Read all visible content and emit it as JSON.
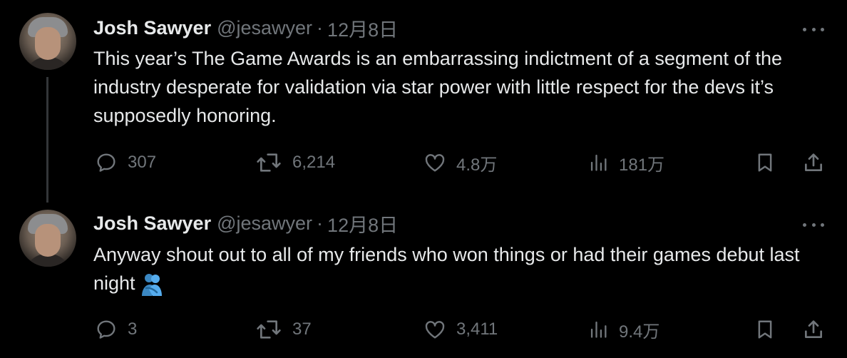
{
  "tweets": [
    {
      "author": {
        "name": "Josh Sawyer",
        "handle": "@jesawyer"
      },
      "separator": "·",
      "date": "12月8日",
      "text": "This year’s The Game Awards is an embarrassing indictment of a segment of the industry desperate for validation via star power with little respect for the devs it’s supposedly honoring.",
      "stats": {
        "replies": "307",
        "reposts": "6,214",
        "likes": "4.8万",
        "views": "181万"
      }
    },
    {
      "author": {
        "name": "Josh Sawyer",
        "handle": "@jesawyer"
      },
      "separator": "·",
      "date": "12月8日",
      "text": "Anyway shout out to all of my friends who won things or had their games debut last night",
      "emoji": "people-hugging-emoji",
      "stats": {
        "replies": "3",
        "reposts": "37",
        "likes": "3,411",
        "views": "9.4万"
      }
    }
  ],
  "colors": {
    "background": "#000000",
    "text": "#e7e9ea",
    "muted": "#71767b",
    "thread_line": "#333639"
  },
  "icons": [
    "reply-icon",
    "repost-icon",
    "like-icon",
    "views-icon",
    "bookmark-icon",
    "share-icon",
    "more-icon"
  ]
}
